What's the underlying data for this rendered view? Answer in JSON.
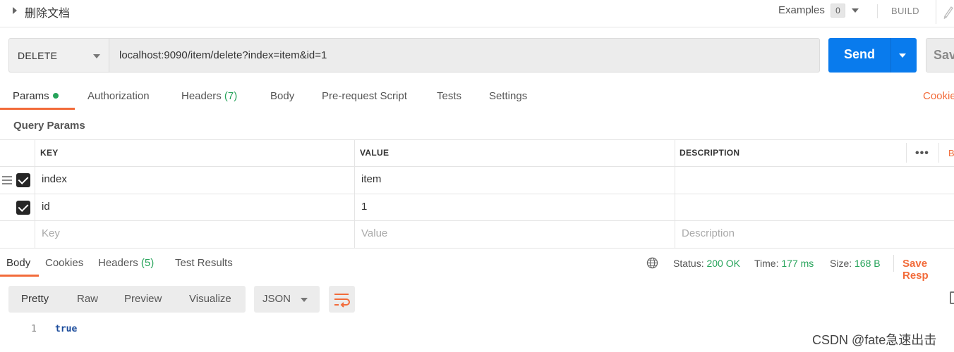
{
  "request": {
    "name": "删除文档",
    "method": "DELETE",
    "url": "localhost:9090/item/delete?index=item&id=1"
  },
  "topbar": {
    "examples_label": "Examples",
    "examples_count": "0",
    "build_label": "BUILD"
  },
  "buttons": {
    "send": "Send",
    "save": "Sav"
  },
  "request_tabs": {
    "params": "Params",
    "authorization": "Authorization",
    "headers": "Headers",
    "headers_count": "(7)",
    "body": "Body",
    "prerequest": "Pre-request Script",
    "tests": "Tests",
    "settings": "Settings",
    "cookies": "Cookie"
  },
  "query_params": {
    "title": "Query Params",
    "columns": [
      "KEY",
      "VALUE",
      "DESCRIPTION"
    ],
    "bulk_label": "B",
    "rows": [
      {
        "key": "index",
        "value": "item",
        "description": "",
        "checked": true
      },
      {
        "key": "id",
        "value": "1",
        "description": "",
        "checked": true
      }
    ],
    "placeholders": {
      "key": "Key",
      "value": "Value",
      "description": "Description"
    }
  },
  "response_tabs": {
    "body": "Body",
    "cookies": "Cookies",
    "headers": "Headers",
    "headers_count": "(5)",
    "test_results": "Test Results"
  },
  "response_status": {
    "status_label": "Status:",
    "status_value": "200 OK",
    "time_label": "Time:",
    "time_value": "177 ms",
    "size_label": "Size:",
    "size_value": "168 B",
    "save_response": "Save Resp"
  },
  "view_modes": [
    "Pretty",
    "Raw",
    "Preview",
    "Visualize"
  ],
  "format": "JSON",
  "response_body": {
    "line_number": "1",
    "content": "true"
  },
  "watermark": "CSDN @fate急速出击",
  "colors": {
    "accent": "#f26b3a",
    "send": "#097bed",
    "success": "#26a35a"
  }
}
